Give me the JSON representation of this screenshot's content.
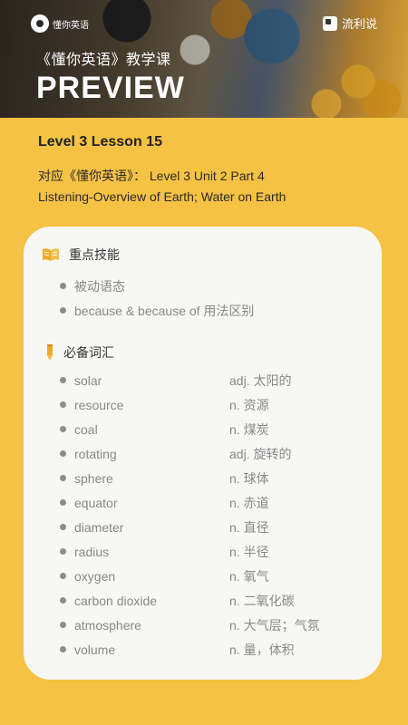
{
  "header": {
    "brand_left": "懂你英语",
    "brand_right": "流利说",
    "course_title": "《懂你英语》教学课",
    "preview_title": "PREVIEW"
  },
  "lesson": {
    "title": "Level 3 Lesson 15",
    "reference_line1": "对应《懂你英语》： Level 3 Unit 2 Part 4",
    "reference_line2": "Listening-Overview of Earth; Water on Earth"
  },
  "key_skills": {
    "heading": "重点技能",
    "icon": "book-icon",
    "items": [
      "被动语态",
      "because & because of 用法区别"
    ]
  },
  "vocabulary": {
    "heading": "必备词汇",
    "icon": "pencil-icon",
    "items": [
      {
        "word": "solar",
        "meaning": "adj. 太阳的"
      },
      {
        "word": "resource",
        "meaning": "n. 资源"
      },
      {
        "word": "coal",
        "meaning": "n. 煤炭"
      },
      {
        "word": "rotating",
        "meaning": "adj. 旋转的"
      },
      {
        "word": "sphere",
        "meaning": "n. 球体"
      },
      {
        "word": "equator",
        "meaning": "n. 赤道"
      },
      {
        "word": "diameter",
        "meaning": "n. 直径"
      },
      {
        "word": "radius",
        "meaning": "n. 半径"
      },
      {
        "word": "oxygen",
        "meaning": "n. 氧气"
      },
      {
        "word": "carbon dioxide",
        "meaning": "n. 二氧化碳"
      },
      {
        "word": "atmosphere",
        "meaning": "n. 大气层；气氛"
      },
      {
        "word": "volume",
        "meaning": "n. 量，体积"
      }
    ]
  },
  "colors": {
    "background": "#f6c244",
    "card": "#f7f7f5",
    "icon_accent": "#f0a92a"
  }
}
